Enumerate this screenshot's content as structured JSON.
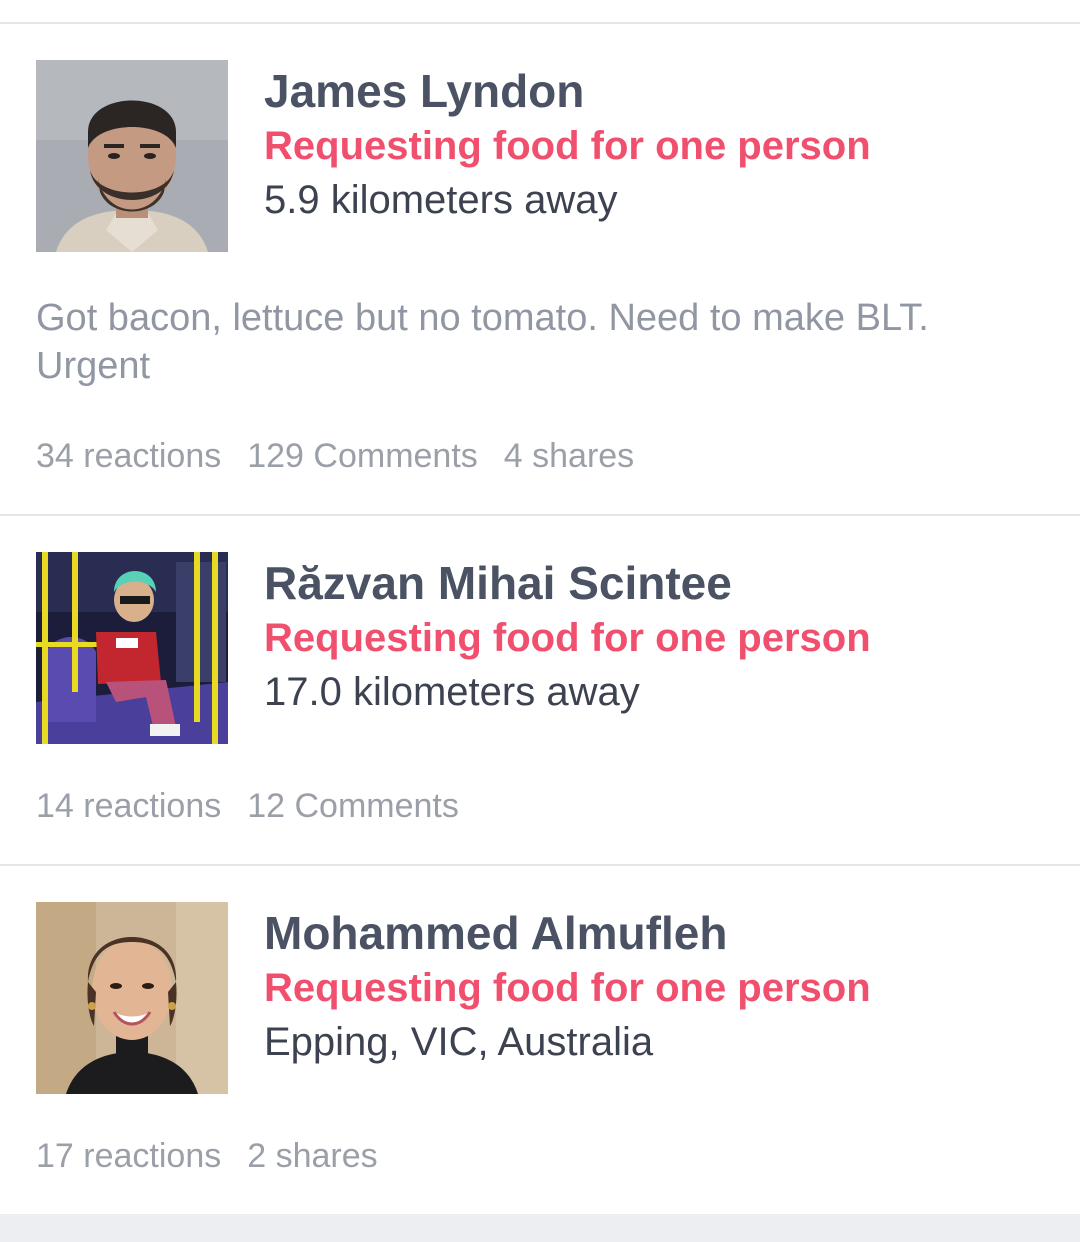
{
  "posts": [
    {
      "name": "James Lyndon",
      "request": "Requesting food for one person",
      "location": "5.9 kilometers away",
      "body": "Got bacon, lettuce but no tomato. Need to make BLT. Urgent",
      "stats": {
        "reactions": "34 reactions",
        "comments": "129 Comments",
        "shares": "4 shares"
      }
    },
    {
      "name": "Răzvan Mihai Scintee",
      "request": "Requesting food for one person",
      "location": "17.0 kilometers away",
      "stats": {
        "reactions": "14 reactions",
        "comments": "12 Comments"
      }
    },
    {
      "name": "Mohammed Almufleh",
      "request": "Requesting food for one person",
      "location": "Epping, VIC, Australia",
      "stats": {
        "reactions": "17 reactions",
        "shares": "2 shares"
      }
    }
  ],
  "colors": {
    "name": "#4a5263",
    "request": "#f0506e",
    "location": "#3c4250",
    "muted": "#9a9fa8",
    "divider": "#e3e5e8"
  }
}
